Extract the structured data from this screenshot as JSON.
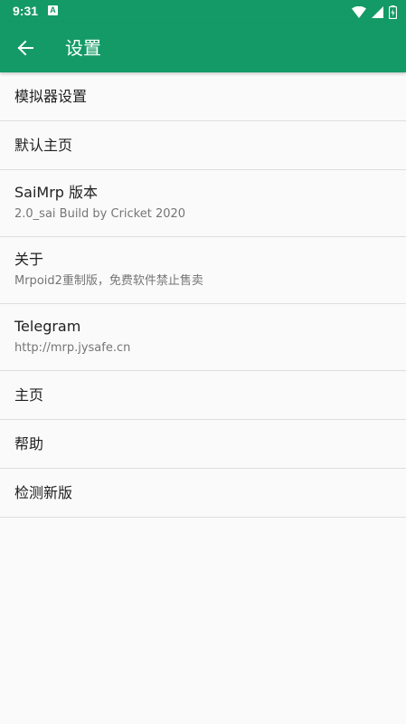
{
  "status_bar": {
    "time": "9:31",
    "notification_icon": "A"
  },
  "app_bar": {
    "title": "设置",
    "background": "#149a66"
  },
  "settings": [
    {
      "title": "模拟器设置"
    },
    {
      "title": "默认主页"
    },
    {
      "title": "SaiMrp 版本",
      "summary": "2.0_sai Build by Cricket 2020"
    },
    {
      "title": "关于",
      "summary": "Mrpoid2重制版，免费软件禁止售卖"
    },
    {
      "title": "Telegram",
      "summary": "http://mrp.jysafe.cn"
    },
    {
      "title": "主页"
    },
    {
      "title": "帮助"
    },
    {
      "title": "检测新版"
    }
  ]
}
